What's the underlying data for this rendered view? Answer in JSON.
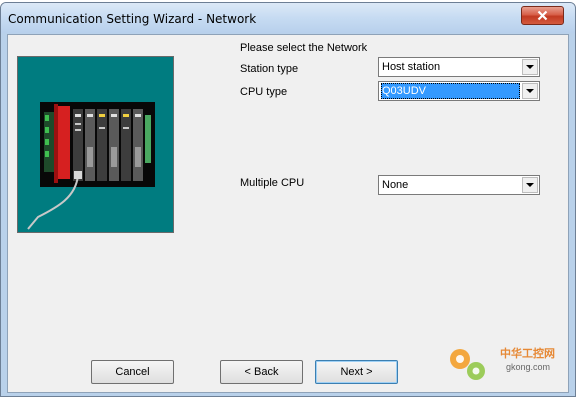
{
  "window": {
    "title": "Communication Setting Wizard - Network"
  },
  "header": {
    "prompt": "Please select the Network"
  },
  "fields": {
    "station_type": {
      "label": "Station type",
      "value": "Host station"
    },
    "cpu_type": {
      "label": "CPU type",
      "value": "Q03UDV"
    },
    "multiple_cpu": {
      "label": "Multiple CPU",
      "value": "None"
    }
  },
  "buttons": {
    "cancel": "Cancel",
    "back": "< Back",
    "next": "Next >"
  },
  "watermark": {
    "text_cn": "中华工控网",
    "domain": "gkong.com"
  },
  "colors": {
    "panel_bg": "#007c80",
    "title_bar": "#c6dbf2",
    "selection": "#3399ff",
    "close_button": "#c23a22"
  }
}
